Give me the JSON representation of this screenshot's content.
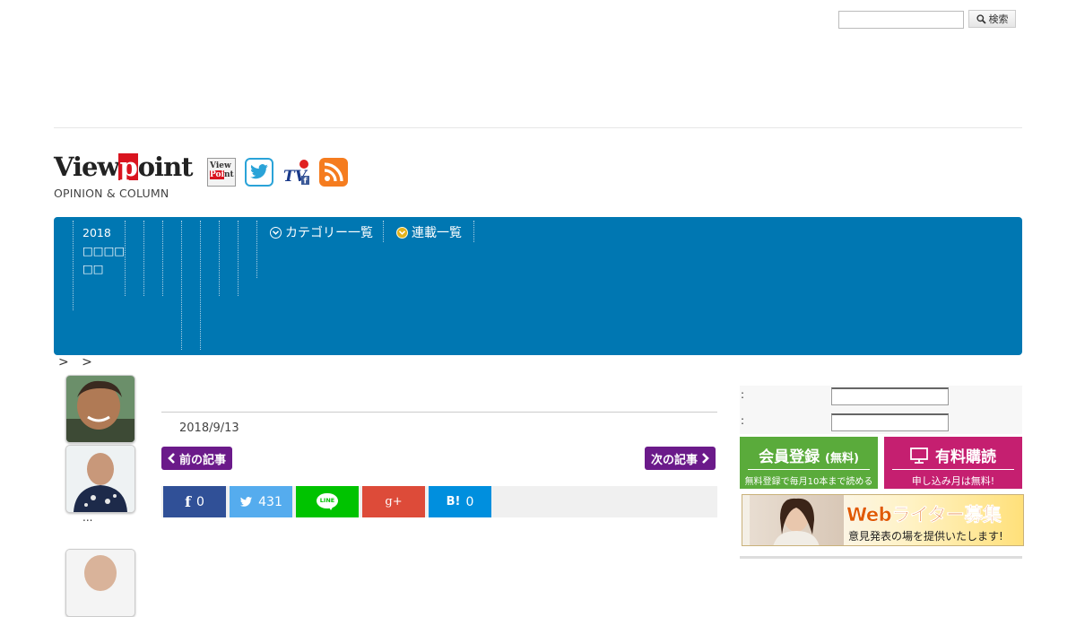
{
  "search": {
    "placeholder": "",
    "button_label": "検索"
  },
  "logo": {
    "main_before": "View",
    "main_p": "p",
    "main_after": "oint",
    "sub": "OPINION & COLUMN"
  },
  "social": {
    "viewpoint_fb_text_1": "View",
    "viewpoint_fb_text_2": "Poi",
    "viewpoint_fb_text_3": "nt",
    "tv_text": "TV"
  },
  "nav": {
    "year": "2018",
    "year_sub_1": "□□□□",
    "year_sub_2": "□□",
    "categories_label": "カテゴリー一覧",
    "series_label": "連載一覧"
  },
  "breadcrumb": {
    "text": "> >"
  },
  "author_list": {
    "ellipsis": "..."
  },
  "article": {
    "date": "2018/9/13",
    "prev_label": "前の記事",
    "next_label": "次の記事"
  },
  "share": {
    "facebook_count": "0",
    "twitter_count": "431",
    "line_label": "LINE",
    "gplus_label": "g+",
    "hatena_label": "B!",
    "hatena_count": "0"
  },
  "login": {
    "label_1": ":",
    "label_2": ":"
  },
  "banners": {
    "register_title": "会員登録",
    "register_title_small": "(無料)",
    "register_sub": "無料登録で毎月10本まで読める",
    "subscribe_title": "有料購読",
    "subscribe_sub": "申し込み月は無料!",
    "writer_title": "Webライター募集",
    "writer_sub": "意見発表の場を提供いたします!"
  },
  "colors": {
    "nav": "#0077b2",
    "page_button": "#6b1a8a",
    "register": "#5aab3b",
    "subscribe": "#c51f70"
  }
}
